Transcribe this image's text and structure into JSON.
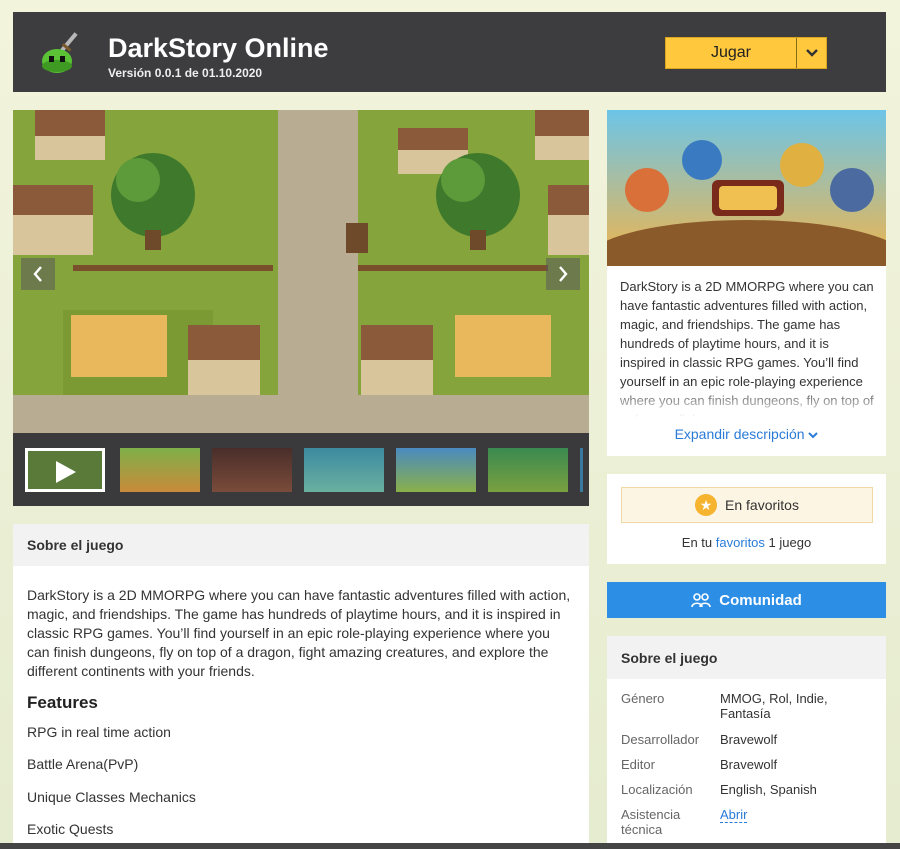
{
  "header": {
    "title": "DarkStory Online",
    "version": "Versión 0.0.1 de 01.10.2020",
    "play_label": "Jugar"
  },
  "about": {
    "heading": "Sobre el juego",
    "description": "DarkStory is a 2D MMORPG where you can have fantastic adventures filled with action, magic, and friendships. The game has hundreds of playtime hours, and it is inspired in classic RPG games. You’ll find yourself in an epic role-playing experience where you can finish dungeons, fly on top of a dragon, fight amazing creatures, and explore the different continents with your friends.",
    "features_title": "Features",
    "features": [
      "RPG in real time action",
      "Battle Arena(PvP)",
      "Unique Classes Mechanics",
      "Exotic Quests"
    ]
  },
  "sidebar": {
    "description": "DarkStory is a 2D MMORPG where you can have fantastic adventures filled with action, magic, and friendships. The game has hundreds of playtime hours, and it is inspired in classic RPG games. You’ll find yourself in an epic role-playing experience where you can finish dungeons, fly on top of a dragon, fight",
    "expand_label": "Expandir descripción",
    "favorites": {
      "button_label": "En favoritos",
      "note_prefix": "En tu",
      "note_link": "favoritos",
      "note_suffix": "1 juego"
    },
    "community_label": "Comunidad",
    "info": {
      "heading": "Sobre el juego",
      "rows": [
        {
          "label": "Género",
          "value": "MMOG, Rol, Indie, Fantasía"
        },
        {
          "label": "Desarrollador",
          "value": "Bravewolf"
        },
        {
          "label": "Editor",
          "value": "Bravewolf"
        },
        {
          "label": "Localización",
          "value": "English, Spanish"
        },
        {
          "label": "Asistencia técnica",
          "value": "Abrir"
        }
      ]
    }
  },
  "colors": {
    "header_bg": "#3d3d3f",
    "play_button": "#ffc83d",
    "link": "#2a7bd8",
    "community_button": "#2d8ee6"
  }
}
